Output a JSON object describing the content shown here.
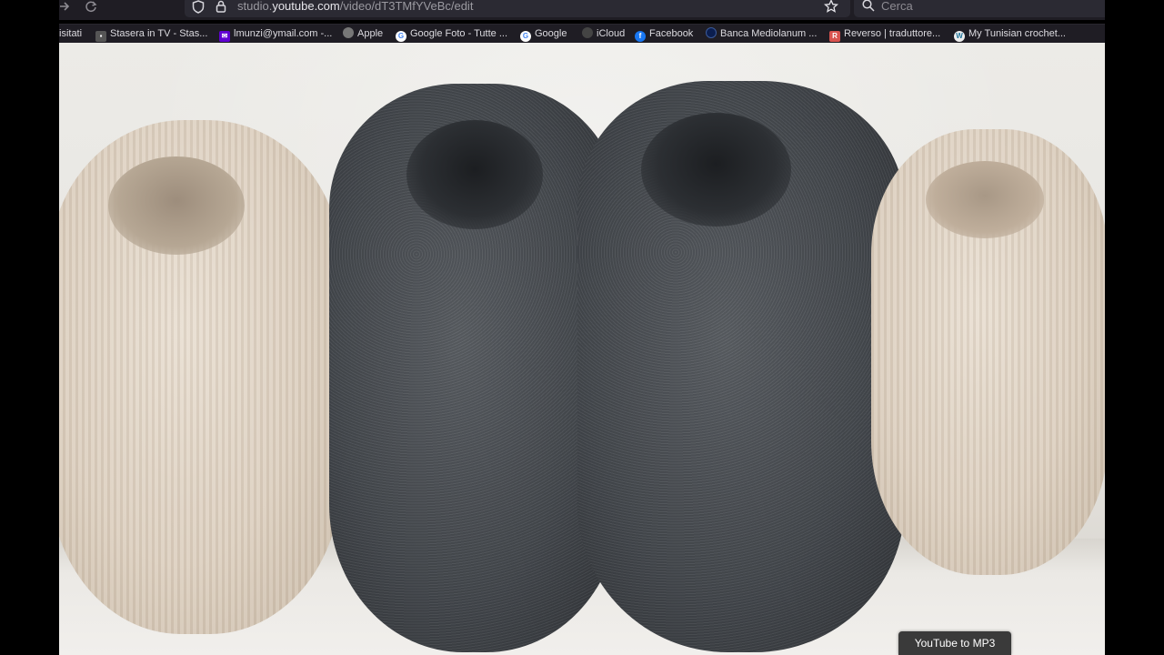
{
  "browser": {
    "url": {
      "domain_prefix": "studio.",
      "domain_main": "youtube.com",
      "path": "/video/dT3TMfYVeBc/edit"
    },
    "search_placeholder": "Cerca",
    "icons": [
      "forward-arrow-icon",
      "reload-icon",
      "shield-icon",
      "lock-icon",
      "star-icon",
      "search-icon"
    ]
  },
  "bookmarks": [
    {
      "label": "isitati",
      "icon": ""
    },
    {
      "label": "Stasera in TV - Stas...",
      "icon": "tv-icon"
    },
    {
      "label": "lmunzi@ymail.com -...",
      "icon": "yahoo-mail-icon"
    },
    {
      "label": "Apple",
      "icon": "apple-icon"
    },
    {
      "label": "Google Foto - Tutte ...",
      "icon": "google-icon"
    },
    {
      "label": "Google",
      "icon": "google-icon"
    },
    {
      "label": "iCloud",
      "icon": "icloud-icon"
    },
    {
      "label": "Facebook",
      "icon": "facebook-icon"
    },
    {
      "label": "Banca Mediolanum ...",
      "icon": "bank-icon"
    },
    {
      "label": "Reverso | traduttore...",
      "icon": "reverso-icon"
    },
    {
      "label": "My Tunisian crochet...",
      "icon": "wordpress-icon"
    }
  ],
  "tooltip": "YouTube to MP3",
  "colors": {
    "toolbar_bg": "#1f1d24",
    "urlbar_bg": "#2b2a33",
    "cream_wool": "#ddd0c0",
    "dark_wool": "#45494e"
  }
}
